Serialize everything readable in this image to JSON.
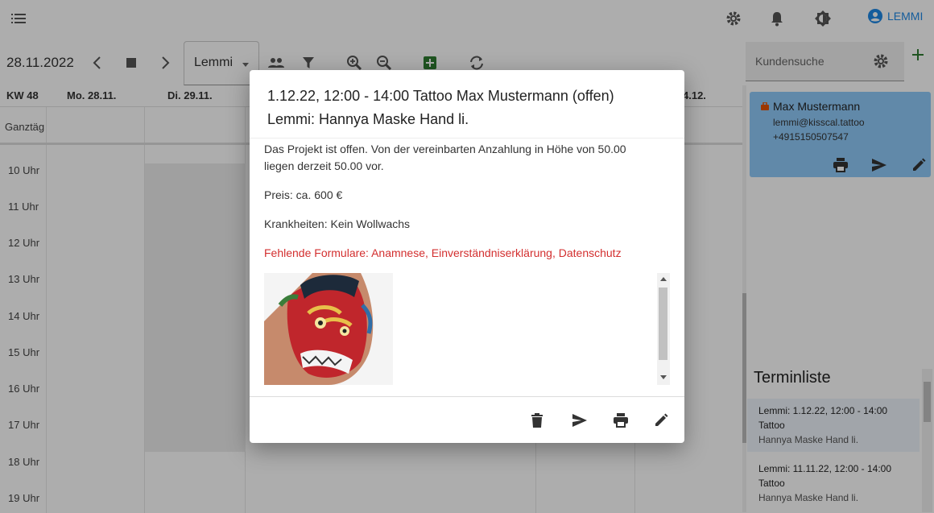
{
  "app": {
    "user_name": "LEMMI"
  },
  "toolbar": {
    "date": "28.11.2022",
    "user_select": "Lemmi"
  },
  "calendar": {
    "week": "KW 48",
    "days": [
      "Mo. 28.11.",
      "Di. 29.11.",
      "4.12."
    ],
    "allday_label": "Ganztäg",
    "hours": [
      "10 Uhr",
      "11 Uhr",
      "12 Uhr",
      "13 Uhr",
      "14 Uhr",
      "15 Uhr",
      "16 Uhr",
      "17 Uhr",
      "18 Uhr",
      "19 Uhr"
    ]
  },
  "sidebar": {
    "search_placeholder": "Kundensuche",
    "customer": {
      "name": "Max Mustermann",
      "email": "lemmi@kisscal.tattoo",
      "phone": "+4915150507547"
    },
    "appointments_title": "Terminliste",
    "appointments": [
      {
        "line1": "Lemmi: 1.12.22, 12:00 - 14:00",
        "line2": "Tattoo",
        "line3": "Hannya Maske Hand li."
      },
      {
        "line1": "Lemmi: 11.11.22, 12:00 - 14:00",
        "line2": "Tattoo",
        "line3": "Hannya Maske Hand li."
      }
    ]
  },
  "dialog": {
    "title_line1": "1.12.22, 12:00 - 14:00 Tattoo Max Mustermann (offen)",
    "title_line2": "Lemmi: Hannya Maske Hand li.",
    "deposit_text": "Das Projekt ist offen. Von der vereinbarten Anzahlung in Höhe von 50.00 liegen derzeit 50.00 vor.",
    "price_text": "Preis: ca. 600 €",
    "illness_text": "Krankheiten: Kein Wollwachs",
    "missing_forms_text": "Fehlende Formulare: Anamnese, Einverständniserklärung, Datenschutz"
  },
  "colors": {
    "accent": "#1e88e5",
    "card_bg": "#90caf9",
    "warning": "#d32f2f",
    "add_green": "#2e7d32"
  }
}
